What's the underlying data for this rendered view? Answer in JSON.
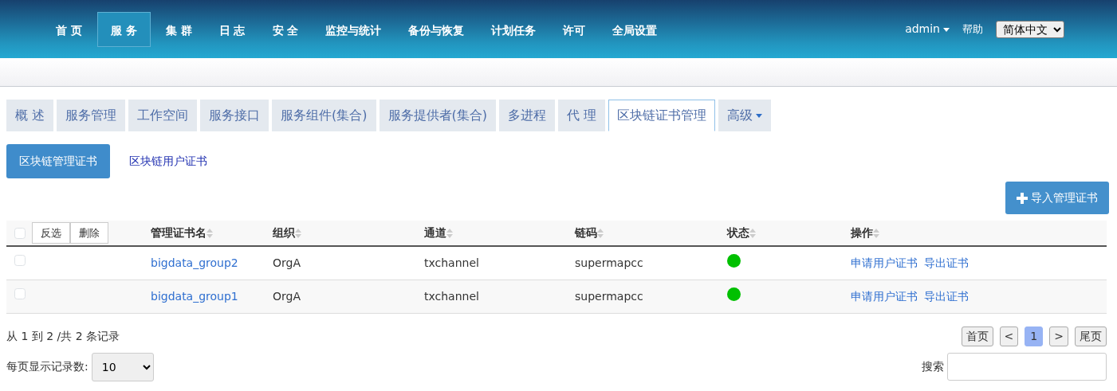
{
  "nav": {
    "items": [
      {
        "label": "首 页",
        "selected": false
      },
      {
        "label": "服 务",
        "selected": true
      },
      {
        "label": "集 群",
        "selected": false
      },
      {
        "label": "日 志",
        "selected": false
      },
      {
        "label": "安 全",
        "selected": false
      },
      {
        "label": "监控与统计",
        "selected": false
      },
      {
        "label": "备份与恢复",
        "selected": false
      },
      {
        "label": "计划任务",
        "selected": false
      },
      {
        "label": "许可",
        "selected": false
      },
      {
        "label": "全局设置",
        "selected": false
      }
    ],
    "user": "admin",
    "help": "帮助",
    "language": "简体中文"
  },
  "tabs": [
    {
      "label": "概 述",
      "selected": false,
      "kind": "tab"
    },
    {
      "label": "服务管理",
      "selected": false,
      "kind": "tab"
    },
    {
      "label": "工作空间",
      "selected": false,
      "kind": "tab"
    },
    {
      "label": "服务接口",
      "selected": false,
      "kind": "tab"
    },
    {
      "label": "服务组件(集合)",
      "selected": false,
      "kind": "tab"
    },
    {
      "label": "服务提供者(集合)",
      "selected": false,
      "kind": "tab"
    },
    {
      "label": "多进程",
      "selected": false,
      "kind": "tab"
    },
    {
      "label": "代 理",
      "selected": false,
      "kind": "tab"
    },
    {
      "label": "区块链证书管理",
      "selected": true,
      "kind": "tab"
    },
    {
      "label": "高级",
      "selected": false,
      "kind": "dropdown"
    }
  ],
  "sub_tabs": [
    {
      "label": "区块链管理证书",
      "selected": true
    },
    {
      "label": "区块链用户证书",
      "selected": false
    }
  ],
  "import_button": "导入管理证书",
  "table": {
    "select_all": {
      "checked": false
    },
    "bulk_buttons": [
      "反选",
      "删除"
    ],
    "columns": [
      "管理证书名",
      "组织",
      "通道",
      "链码",
      "状态",
      "操作"
    ],
    "rows": [
      {
        "checked": false,
        "name": "bigdata_group2",
        "org": "OrgA",
        "channel": "txchannel",
        "chaincode": "supermapcc",
        "color": "#00c000",
        "actions": [
          "申请用户证书",
          "导出证书"
        ]
      },
      {
        "checked": false,
        "name": "bigdata_group1",
        "org": "OrgA",
        "channel": "txchannel",
        "chaincode": "supermapcc",
        "color": "#00c000",
        "actions": [
          "申请用户证书",
          "导出证书"
        ]
      }
    ]
  },
  "footer": {
    "summary": "从 1 到 2 /共 2 条记录",
    "page_size_label": "每页显示记录数:",
    "page_size": "10",
    "pagination": [
      {
        "label": "首页",
        "selected": false
      },
      {
        "label": "<",
        "selected": false
      },
      {
        "label": "1",
        "selected": true
      },
      {
        "label": ">",
        "selected": false
      },
      {
        "label": "尾页",
        "selected": false
      }
    ],
    "search_label": "搜索"
  }
}
